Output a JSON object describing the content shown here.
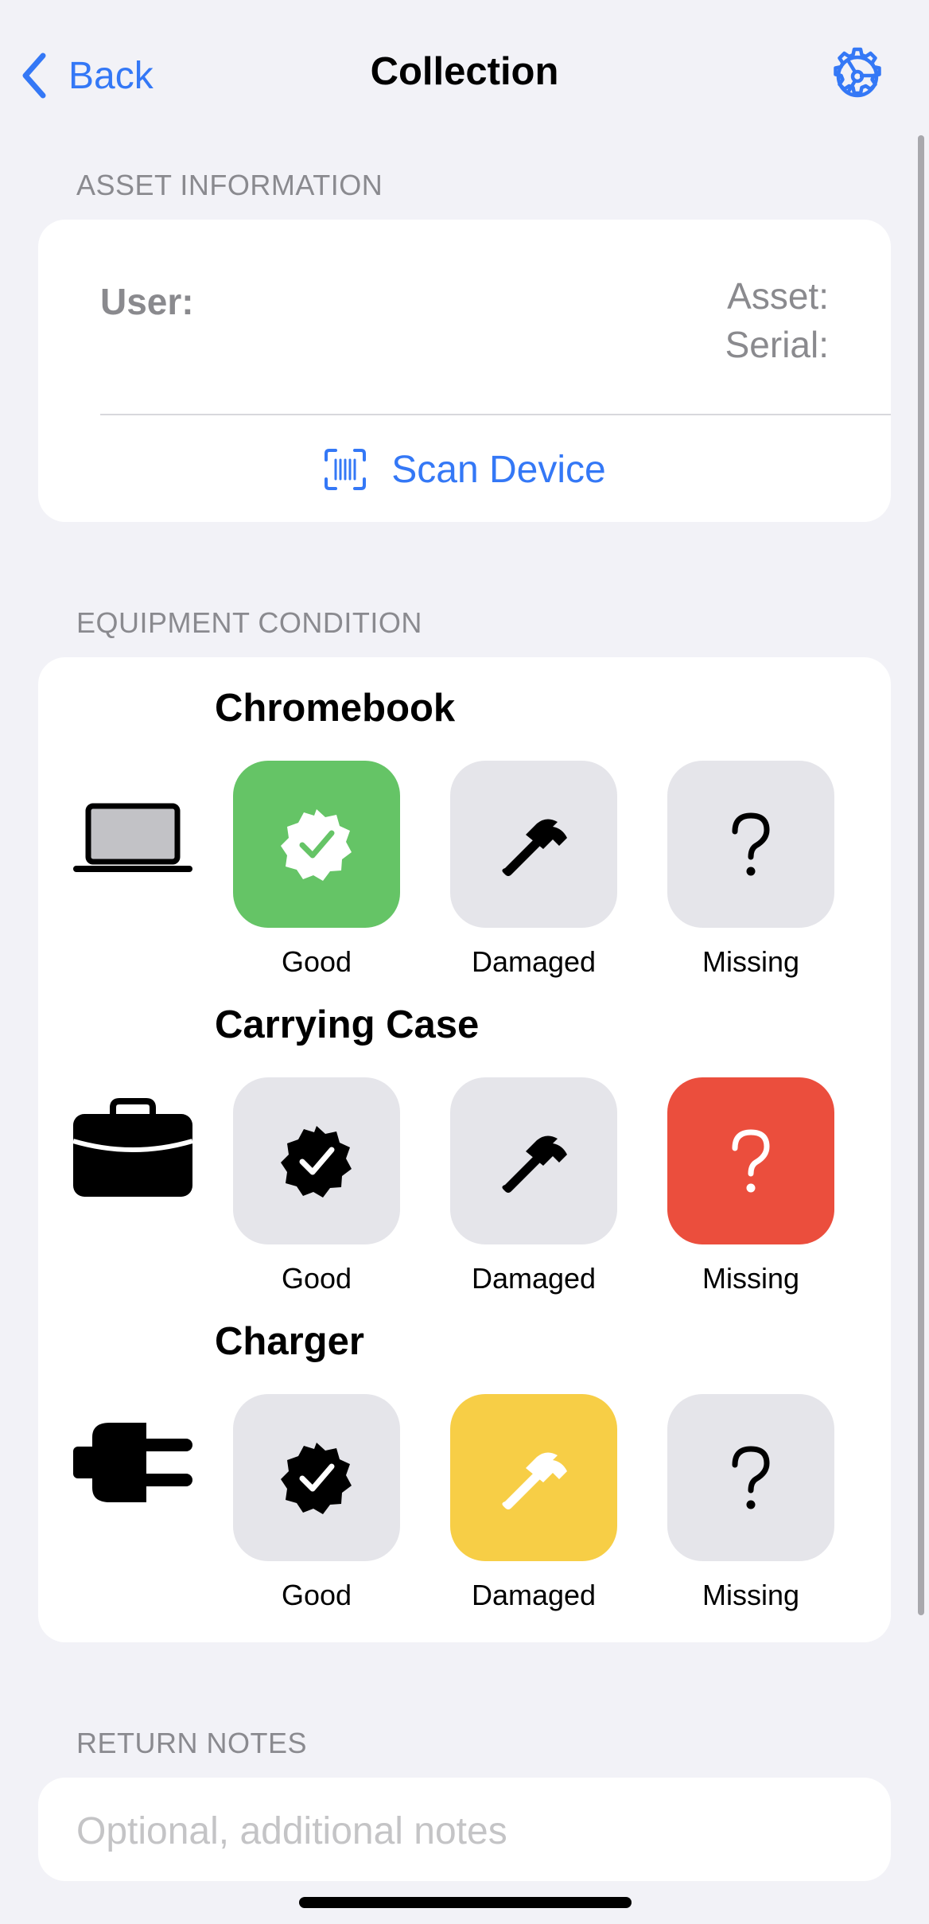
{
  "nav": {
    "back_label": "Back",
    "title": "Collection",
    "settings_icon": "gear-icon"
  },
  "asset_information": {
    "header": "ASSET INFORMATION",
    "user_label": "User:",
    "asset_label": "Asset:",
    "serial_label": "Serial:",
    "scan_label": "Scan Device",
    "scan_icon": "barcode-viewfinder-icon"
  },
  "equipment_condition": {
    "header": "EQUIPMENT CONDITION",
    "items": [
      {
        "label": "Chromebook",
        "icon": "laptop-icon",
        "options": [
          {
            "label": "Good",
            "selected": true
          },
          {
            "label": "Damaged",
            "selected": false
          },
          {
            "label": "Missing",
            "selected": false
          }
        ]
      },
      {
        "label": "Carrying Case",
        "icon": "briefcase-icon",
        "options": [
          {
            "label": "Good",
            "selected": false
          },
          {
            "label": "Damaged",
            "selected": false
          },
          {
            "label": "Missing",
            "selected": true
          }
        ]
      },
      {
        "label": "Charger",
        "icon": "plug-icon",
        "options": [
          {
            "label": "Good",
            "selected": false
          },
          {
            "label": "Damaged",
            "selected": true
          },
          {
            "label": "Missing",
            "selected": false
          }
        ]
      }
    ]
  },
  "return_notes": {
    "header": "RETURN NOTES",
    "placeholder": "Optional, additional notes"
  },
  "colors": {
    "accent": "#3478f6",
    "good_selected": "#65c466",
    "damaged_selected": "#f7ce46",
    "missing_selected": "#eb4e3d",
    "unselected": "#e5e5ea"
  }
}
